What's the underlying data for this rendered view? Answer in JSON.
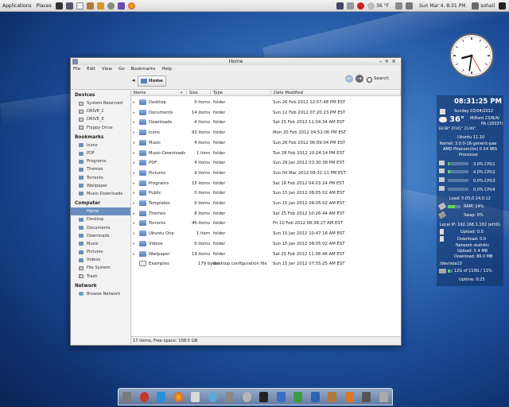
{
  "panel": {
    "applications_label": "Applications",
    "places_label": "Places",
    "temperature": "36 °F",
    "datetime": "Sun Mar  4,  8:31 PM",
    "user": "sohail",
    "launcher_icons": [
      "terminal-icon",
      "monitor-icon",
      "text-editor-icon",
      "box-icon",
      "chat-icon",
      "settings-icon",
      "messenger-icon",
      "firefox-icon"
    ]
  },
  "window": {
    "title": "Home",
    "menu": [
      "File",
      "Edit",
      "View",
      "Go",
      "Bookmarks",
      "Help"
    ],
    "location": "Home",
    "search_label": "Search"
  },
  "sidebar": {
    "sections": [
      {
        "heading": "Devices",
        "items": [
          "System Reserved",
          "DRIVE_C",
          "DRIVE_E",
          "Floppy Drive"
        ]
      },
      {
        "heading": "Bookmarks",
        "items": [
          "Icons",
          "PDF",
          "Programs",
          "Themes",
          "Torrents",
          "Wallpaper",
          "Music-Downloads"
        ]
      },
      {
        "heading": "Computer",
        "items": [
          "Home",
          "Desktop",
          "Documents",
          "Downloads",
          "Music",
          "Pictures",
          "Videos",
          "File System",
          "Trash"
        ]
      },
      {
        "heading": "Network",
        "items": [
          "Browse Network"
        ]
      }
    ],
    "selected": "Home"
  },
  "columns": [
    "Name",
    "Size",
    "Type",
    "Date Modified"
  ],
  "files": [
    {
      "name": "Desktop",
      "size": "0 items",
      "type": "folder",
      "date": "Sun 26 Feb 2012 12:57:48 PM EST",
      "kind": "folder"
    },
    {
      "name": "Documents",
      "size": "14 items",
      "type": "folder",
      "date": "Sun 12 Feb 2012 07:20:23 PM EST",
      "kind": "folder"
    },
    {
      "name": "Downloads",
      "size": "4 items",
      "type": "folder",
      "date": "Sat 25 Feb 2012 11:04:34 AM EST",
      "kind": "folder"
    },
    {
      "name": "Icons",
      "size": "93 items",
      "type": "folder",
      "date": "Mon 20 Feb 2012 04:52:06 PM EST",
      "kind": "folder"
    },
    {
      "name": "Music",
      "size": "4 items",
      "type": "folder",
      "date": "Sun 26 Feb 2012 06:09:04 PM EST",
      "kind": "folder"
    },
    {
      "name": "Music-Downloads",
      "size": "1 item",
      "type": "folder",
      "date": "Tue 28 Feb 2012 10:24:14 PM EST",
      "kind": "folder"
    },
    {
      "name": "PDF",
      "size": "4 items",
      "type": "folder",
      "date": "Sun 29 Jan 2012 03:30:38 PM EST",
      "kind": "folder"
    },
    {
      "name": "Pictures",
      "size": "9 items",
      "type": "folder",
      "date": "Sun 04 Mar 2012 08:31:11 PM EST",
      "kind": "folder"
    },
    {
      "name": "Programs",
      "size": "15 items",
      "type": "folder",
      "date": "Sat 18 Feb 2012 04:03:24 PM EST",
      "kind": "folder"
    },
    {
      "name": "Public",
      "size": "0 items",
      "type": "folder",
      "date": "Sun 15 Jan 2012 08:05:02 AM EST",
      "kind": "folder"
    },
    {
      "name": "Templates",
      "size": "0 items",
      "type": "folder",
      "date": "Sun 15 Jan 2012 08:05:02 AM EST",
      "kind": "folder"
    },
    {
      "name": "Themes",
      "size": "8 items",
      "type": "folder",
      "date": "Sat 25 Feb 2012 10:26:44 AM EST",
      "kind": "folder"
    },
    {
      "name": "Torrents",
      "size": "46 items",
      "type": "folder",
      "date": "Fri 10 Feb 2012 08:38:27 AM EST",
      "kind": "folder"
    },
    {
      "name": "Ubuntu One",
      "size": "1 item",
      "type": "folder",
      "date": "Sun 15 Jan 2012 10:47:16 AM EST",
      "kind": "folder"
    },
    {
      "name": "Videos",
      "size": "0 items",
      "type": "folder",
      "date": "Sun 15 Jan 2012 08:05:02 AM EST",
      "kind": "folder"
    },
    {
      "name": "Wallpaper",
      "size": "19 items",
      "type": "folder",
      "date": "Sat 25 Feb 2012 11:06:46 AM EST",
      "kind": "folder"
    },
    {
      "name": "Examples",
      "size": "179 bytes",
      "type": "desktop configuration file",
      "date": "Sun 15 Jan 2012 07:55:25 AM EST",
      "kind": "doc"
    }
  ],
  "status": "17 items, Free space: 108.5 GB",
  "conky": {
    "time": "08:31:25 PM",
    "date": "Sunday 03/04/2012",
    "temp": "36°",
    "location1": "Milford 23/N/A/",
    "location2": "PA (18337)",
    "minmax": "18/38° 27/41° 21/40°",
    "os": "Ubuntu 11.10",
    "kernel": "Kernel: 3.0.0-16-generic-pae",
    "cpu_model": "AMD Phenom(tm) II X4 965",
    "cpu_model2": "Processor",
    "cpus": [
      {
        "label": "3.0% CPU1",
        "fill": 0.03
      },
      {
        "label": "4.0% CPU2",
        "fill": 0.04
      },
      {
        "label": "0.0% CPU3",
        "fill": 0.0
      },
      {
        "label": "0.0% CPU4",
        "fill": 0.0
      }
    ],
    "load": "Load: 0.05,0.14,0.12",
    "ram": "RAM: 14%",
    "ram_fill": 0.14,
    "swap": "Swap: 0%",
    "local_ip": "Local IP: 192.168.1.102 (eth0)",
    "upload": "Upload: 0.0",
    "download": "Download: 0.0",
    "net_stat": "Network statistic",
    "net_up": "Upload: 5.4 MB",
    "net_down": "Download: 86.0 MB",
    "disk": "/dev/sda10",
    "disk_usage": "12G of 119G / 11%",
    "disk_fill": 0.11,
    "uptime": "Uptime: 0:25"
  },
  "clock": {
    "hour": 8,
    "minute": 31,
    "second": 25
  },
  "dock_icons": [
    "finder-icon",
    "apps-icon",
    "pictures-icon",
    "firefox-icon",
    "mail-icon",
    "music-icon",
    "network-icon",
    "search-icon",
    "terminal-icon",
    "office-icon",
    "spreadsheet-icon",
    "chat-icon",
    "package-icon",
    "settings-icon",
    "photo-icon",
    "trash-icon"
  ]
}
